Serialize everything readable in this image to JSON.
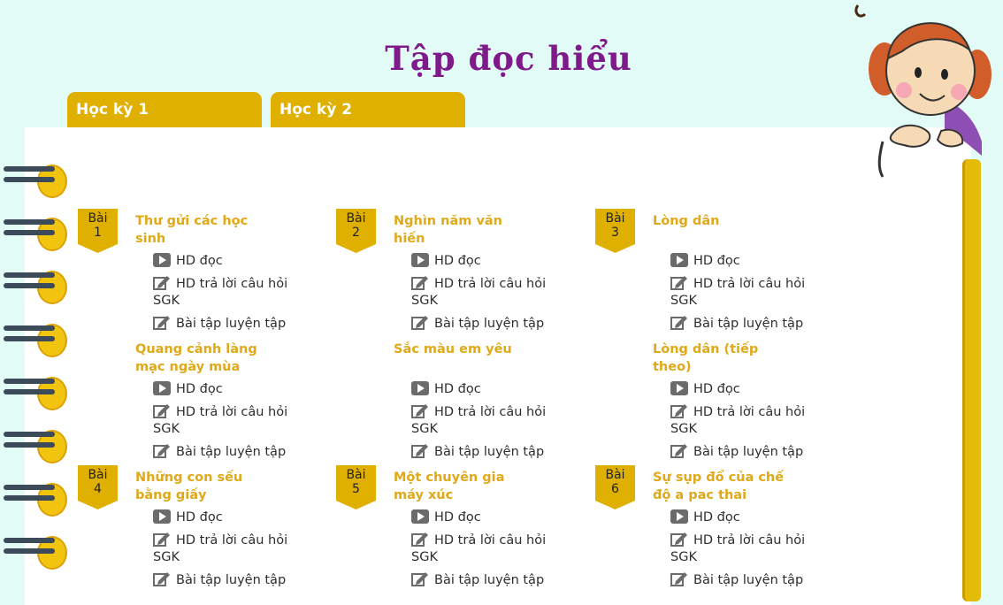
{
  "page": {
    "title": "Tập đọc hiểu"
  },
  "tabs": [
    {
      "label": "Học kỳ 1"
    },
    {
      "label": "Học kỳ 2"
    }
  ],
  "badge_prefix": "Bài",
  "links": {
    "read": "HD đọc",
    "answer": "HD trả lời câu hỏi",
    "answer_cont": "SGK",
    "exercise": "Bài tập luyện tập"
  },
  "icons": {
    "read": "play-icon",
    "answer": "edit-icon",
    "exercise": "edit-icon"
  },
  "colors": {
    "accent": "#dfb000",
    "title": "#7e1a8a",
    "lesson_title": "#dfa91a",
    "background": "#e2fbf6"
  },
  "lessons": [
    {
      "num": "1",
      "items": [
        {
          "title": "Thư gửi các học sinh"
        },
        {
          "title": "Quang cảnh làng mạc ngày mùa"
        }
      ]
    },
    {
      "num": "2",
      "items": [
        {
          "title": "Nghìn năm văn hiến"
        },
        {
          "title": "Sắc màu em yêu"
        }
      ]
    },
    {
      "num": "3",
      "items": [
        {
          "title": "Lòng dân"
        },
        {
          "title": "Lòng dân (tiếp theo)"
        }
      ]
    },
    {
      "num": "4",
      "items": [
        {
          "title": "Những con sếu bằng giấy"
        }
      ]
    },
    {
      "num": "5",
      "items": [
        {
          "title": "Một chuyên gia máy xúc"
        }
      ]
    },
    {
      "num": "6",
      "items": [
        {
          "title": "Sự sụp đổ của chế độ a pac thai"
        }
      ]
    }
  ]
}
